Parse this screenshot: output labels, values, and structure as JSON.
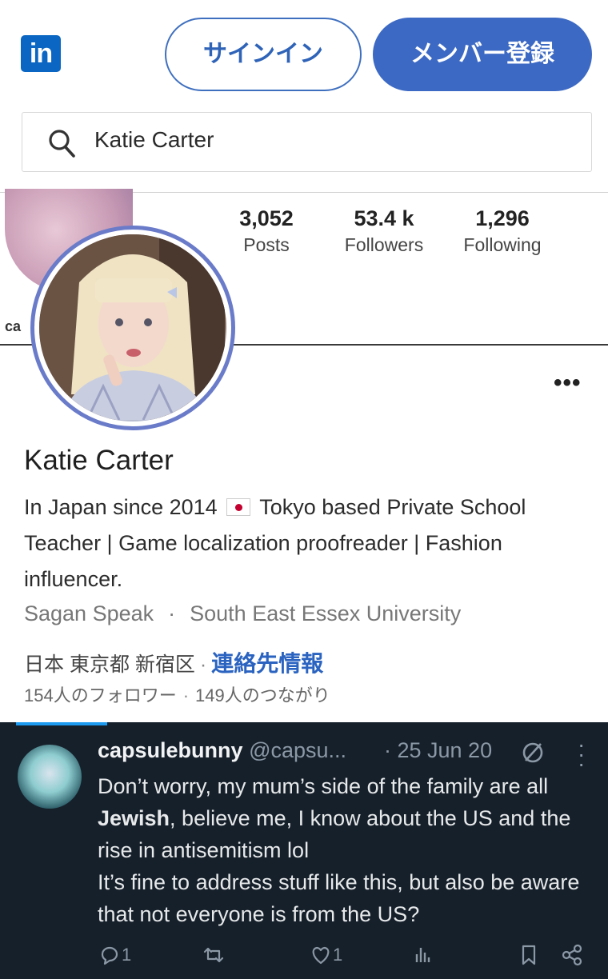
{
  "header": {
    "logo_text": "in",
    "signin_label": "サインイン",
    "join_label": "メンバー登録"
  },
  "search": {
    "value": "Katie Carter"
  },
  "instagram": {
    "tag": "ca",
    "stats": [
      {
        "num": "3,052",
        "label": "Posts"
      },
      {
        "num": "53.4 k",
        "label": "Followers"
      },
      {
        "num": "1,296",
        "label": "Following"
      }
    ]
  },
  "profile": {
    "name": "Katie Carter",
    "bio_part1": "In Japan since 2014",
    "bio_part2": "Tokyo based Private School Teacher | Game localization proofreader | Fashion influencer.",
    "company": "Sagan Speak",
    "school": "South East Essex University",
    "location": "日本 東京都 新宿区",
    "contact_info": "連絡先情報",
    "followers": "154人のフォロワー",
    "connections": "149人のつながり",
    "separator": "·"
  },
  "tweet": {
    "username": "capsulebunny",
    "handle": "@capsu...",
    "time": "· 25 Jun 20",
    "line1_pre": "Don’t worry, my mum’s side of the family are all",
    "line1_bold": "Jewish",
    "line1_post": ", believe me, I know about the US and the rise in antisemitism lol",
    "line2": "It’s fine to address stuff like this, but also be aware that not everyone is from the US?",
    "reply_count": "1",
    "like_count": "1"
  },
  "colors": {
    "linkedin_blue": "#0a66c2",
    "join_button": "#3c69c4",
    "tweet_bg": "#16202b",
    "contact_link": "#2a63c0"
  },
  "icons": [
    "search-icon",
    "more-icon",
    "reply-icon",
    "retweet-icon",
    "like-icon",
    "views-icon",
    "bookmark-icon",
    "share-icon",
    "no-entry-icon",
    "kebab-icon"
  ]
}
